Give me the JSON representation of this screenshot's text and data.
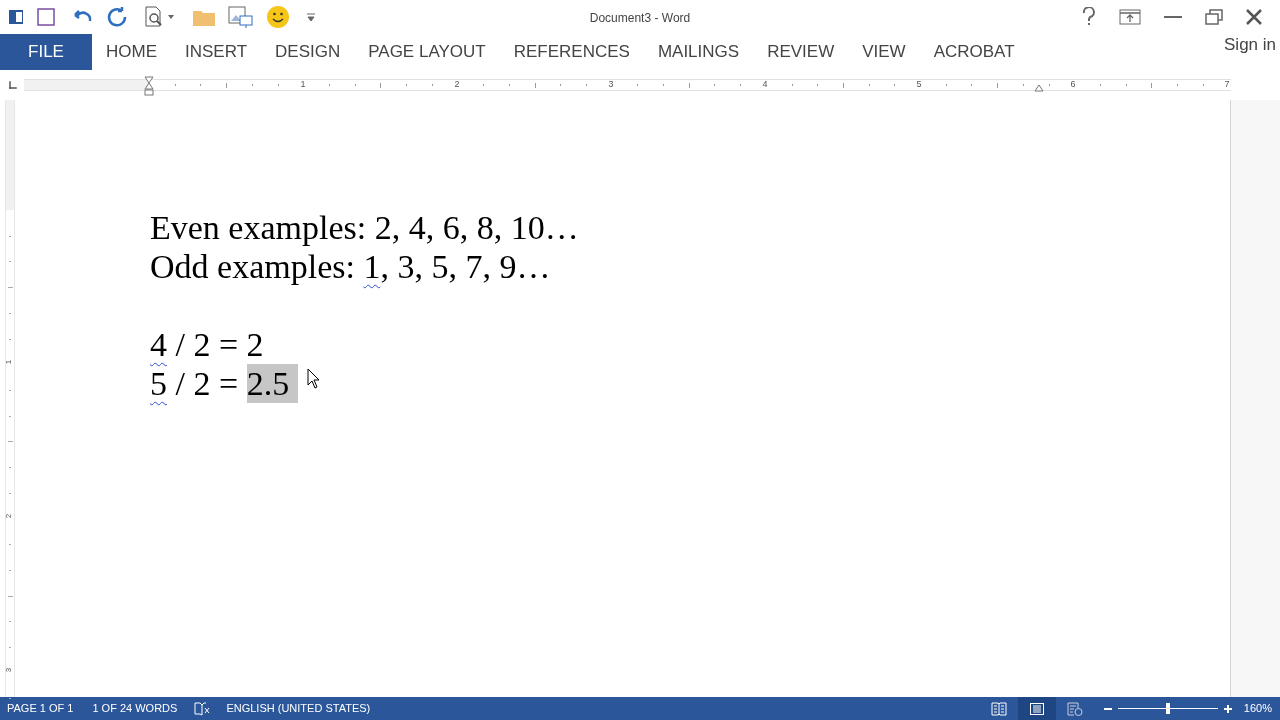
{
  "window": {
    "title": "Document3 - Word"
  },
  "ribbon_tabs": [
    {
      "label": "FILE",
      "selected": true
    },
    {
      "label": "HOME",
      "selected": false
    },
    {
      "label": "INSERT",
      "selected": false
    },
    {
      "label": "DESIGN",
      "selected": false
    },
    {
      "label": "PAGE LAYOUT",
      "selected": false
    },
    {
      "label": "REFERENCES",
      "selected": false
    },
    {
      "label": "MAILINGS",
      "selected": false
    },
    {
      "label": "REVIEW",
      "selected": false
    },
    {
      "label": "VIEW",
      "selected": false
    },
    {
      "label": "ACROBAT",
      "selected": false
    }
  ],
  "account": {
    "label": "Sign in"
  },
  "ruler": {
    "marks": [
      "1",
      "2",
      "3",
      "4",
      "5",
      "6",
      "7"
    ]
  },
  "vertical_ruler": {
    "marks": [
      "1",
      "2",
      "3"
    ]
  },
  "document": {
    "lines": [
      [
        {
          "text": "Even examples: 2, 4, 6, 8, 10…",
          "kind": "plain"
        }
      ],
      [
        {
          "text": "Odd examples: ",
          "kind": "plain"
        },
        {
          "text": "1",
          "kind": "flagged"
        },
        {
          "text": ", 3, 5, 7, 9…",
          "kind": "plain"
        }
      ],
      [
        {
          "text": "4",
          "kind": "flagged",
          "space_before": true
        },
        {
          "text": " / 2 = 2",
          "kind": "plain"
        }
      ],
      [
        {
          "text": "5",
          "kind": "flagged"
        },
        {
          "text": " / 2 = ",
          "kind": "plain"
        },
        {
          "text": "2.5 ",
          "kind": "selected"
        }
      ]
    ]
  },
  "status_bar": {
    "page": "PAGE 1 OF 1",
    "words": "1 OF 24 WORDS",
    "language": "ENGLISH (UNITED STATES)",
    "views": [
      {
        "kind": "read",
        "selected": false
      },
      {
        "kind": "print",
        "selected": true
      },
      {
        "kind": "web",
        "selected": false
      }
    ],
    "zoom": {
      "level": 0.5,
      "reading": "160%"
    }
  }
}
